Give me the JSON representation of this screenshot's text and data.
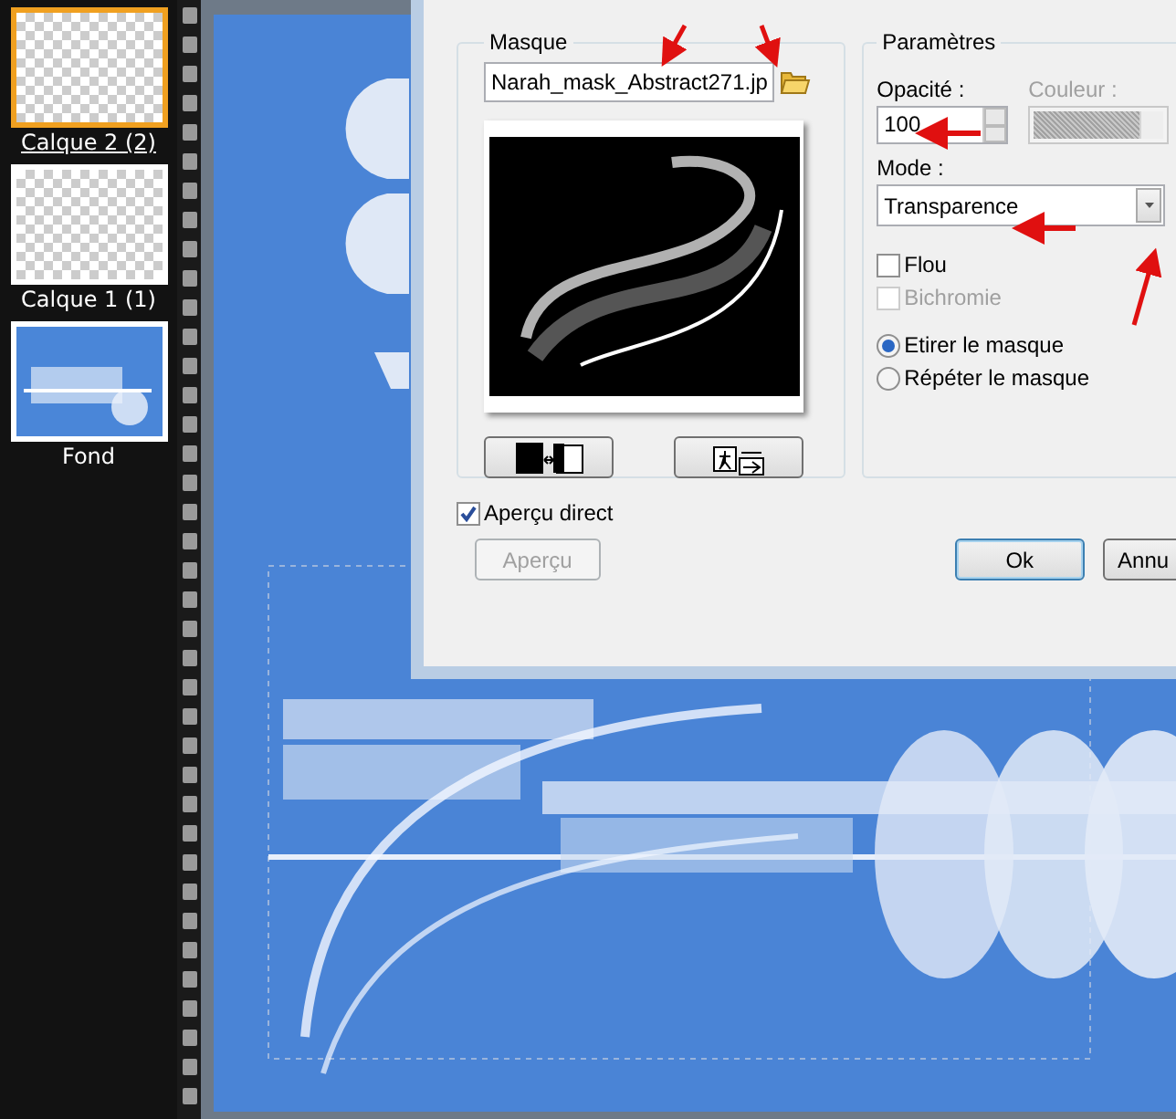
{
  "layers": [
    {
      "name": "Calque 2 (2)",
      "selected": true,
      "kind": "transparent"
    },
    {
      "name": "Calque 1 (1)",
      "selected": false,
      "kind": "transparent"
    },
    {
      "name": "Fond",
      "selected": false,
      "kind": "image"
    }
  ],
  "dialog": {
    "mask_group": {
      "title": "Masque",
      "file": "Narah_mask_Abstract271.jp"
    },
    "params": {
      "title": "Paramètres",
      "opacity_label": "Opacité :",
      "opacity": "100",
      "color_label": "Couleur :",
      "color_disabled": true,
      "mode_label": "Mode :",
      "mode": "Transparence",
      "checkboxes": [
        {
          "label": "Flou",
          "checked": false,
          "disabled": false
        },
        {
          "label": "Bichromie",
          "checked": false,
          "disabled": true
        }
      ],
      "radios": [
        {
          "label": "Etirer le masque",
          "selected": true
        },
        {
          "label": "Répéter le masque",
          "selected": false
        }
      ]
    },
    "live_preview": {
      "label": "Aperçu direct",
      "checked": true
    },
    "buttons": [
      {
        "label": "Aperçu",
        "disabled": true,
        "default": false
      },
      {
        "label": "Ok",
        "disabled": false,
        "default": true
      },
      {
        "label": "Annu",
        "disabled": false,
        "default": false
      }
    ]
  }
}
